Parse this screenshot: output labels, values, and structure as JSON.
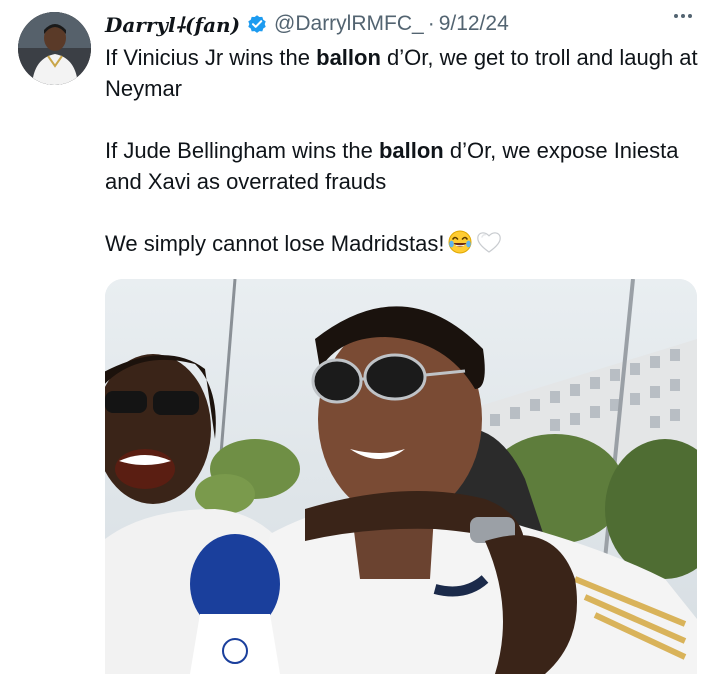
{
  "tweet": {
    "display_name": "Darryl",
    "name_symbol": "⸸",
    "name_suffix": "(fan)",
    "handle": "@DarrylRMFC_",
    "separator": "·",
    "date": "9/12/24",
    "verified_color": "#1d9bf0",
    "lines": {
      "p1_a": "If Vinicius Jr wins the ",
      "p1_bold": "ballon",
      "p1_b": " d’Or, we get to troll and laugh at Neymar",
      "p2_a": "If Jude Bellingham wins the ",
      "p2_bold": "ballon",
      "p2_b": " d’Or, we expose Iniesta and Xavi as overrated frauds",
      "p3": "We simply cannot lose Madridstas!"
    },
    "emojis": [
      "face-with-tears-of-joy",
      "white-heart"
    ],
    "icons": [
      "verified-badge-icon",
      "more-options-icon"
    ]
  }
}
